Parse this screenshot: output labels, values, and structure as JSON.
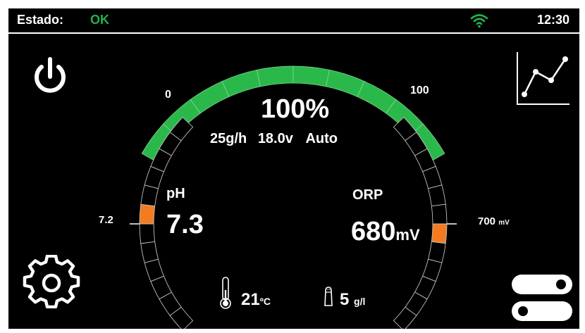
{
  "status": {
    "label": "Estado:",
    "value": "OK",
    "value_color": "#21b24b",
    "time": "12:30"
  },
  "gauge": {
    "min_label": "0",
    "max_label": "100",
    "percent_label": "100%",
    "level": 100,
    "fill_color": "#2bb84a",
    "production": "25g/h",
    "voltage": "18.0v",
    "mode": "Auto"
  },
  "ph": {
    "label": "pH",
    "value": "7.3",
    "setpoint_label": "7.2",
    "indicator_color": "#f47c20"
  },
  "orp": {
    "label": "ORP",
    "value": "680",
    "unit": "mV",
    "setpoint_label": "700",
    "setpoint_unit": "mV",
    "indicator_color": "#f47c20"
  },
  "temperature": {
    "value": "21",
    "unit": "ºC"
  },
  "salt": {
    "value": "5",
    "unit": "g/l"
  },
  "icons": {
    "power": "power-icon",
    "chart": "line-chart-icon",
    "settings": "gear-icon",
    "toggles": "toggles-icon",
    "wifi": "wifi-icon",
    "thermometer": "thermometer-icon",
    "salt": "salt-shaker-icon"
  }
}
